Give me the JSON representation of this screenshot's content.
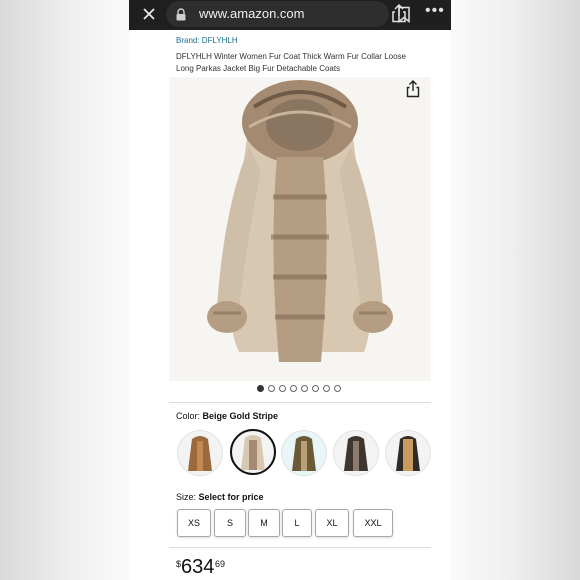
{
  "browser": {
    "url": "www.amazon.com"
  },
  "product": {
    "brand": "Brand: DFLYHLH",
    "title": "DFLYHLH Winter Women Fur Coat Thick Warm Fur Collar Loose Long Parkas Jacket Big Fur Detachable Coats",
    "image_count": 8,
    "active_image_index": 0
  },
  "color": {
    "label": "Color:",
    "selected": "Beige Gold Stripe"
  },
  "size": {
    "label": "Size:",
    "selected": "Select for price",
    "options": [
      "XS",
      "S",
      "M",
      "L",
      "XL",
      "XXL"
    ]
  },
  "price": {
    "symbol": "$",
    "whole": "634",
    "fraction": "69"
  },
  "icons": [
    "close-icon",
    "lock-icon",
    "bookmark-icon",
    "share-icon",
    "more-icon"
  ],
  "colors": {
    "brand_link": "#1c6f8c",
    "browser_bar": "#1f1f1f",
    "coat_beige": "#d8c8b2",
    "fur": "#a48a70"
  }
}
